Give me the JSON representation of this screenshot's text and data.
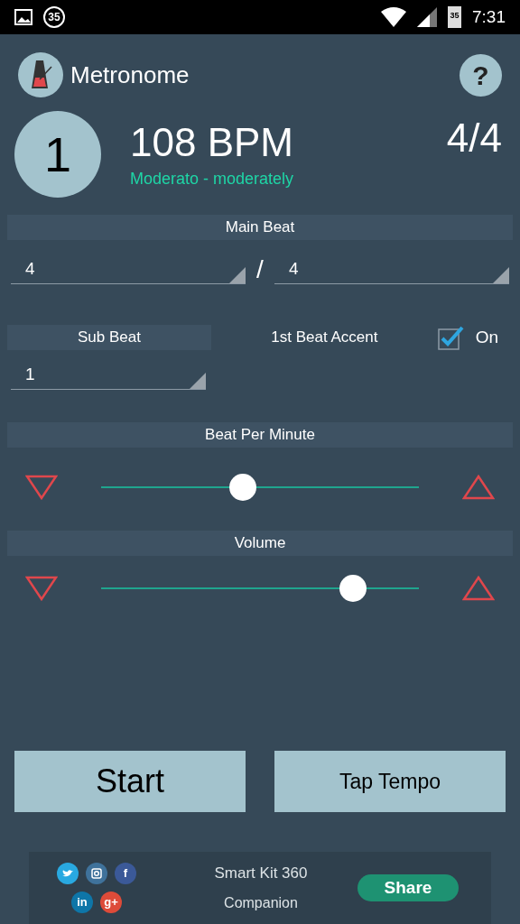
{
  "status_bar": {
    "badge": "35",
    "battery": "35",
    "time": "7:31"
  },
  "header": {
    "title": "Metronome",
    "help": "?"
  },
  "display": {
    "beat": "1",
    "tempo": "108 BPM",
    "tempo_name": "Moderato - moderately",
    "signature": "4/4"
  },
  "main_beat": {
    "title": "Main Beat",
    "numerator": "4",
    "separator": "/",
    "denominator": "4"
  },
  "sub_beat": {
    "title": "Sub Beat",
    "value": "1"
  },
  "accent": {
    "label": "1st Beat Accent",
    "checked": true,
    "state": "On"
  },
  "sliders": [
    {
      "title": "Beat Per Minute",
      "level": 0.44
    },
    {
      "title": "Volume",
      "level": 0.82
    }
  ],
  "buttons": [
    {
      "label": "Start",
      "kind": "primary"
    },
    {
      "label": "Tap Tempo",
      "kind": "secondary"
    }
  ],
  "ad": {
    "social": [
      {
        "kind": "bird",
        "color": "#29a9e1"
      },
      {
        "kind": "camera",
        "color": "#3f729b"
      },
      {
        "kind": "text",
        "label": "f",
        "color": "#3b5998"
      },
      {
        "kind": "text",
        "label": "in",
        "color": "#0e76a8"
      },
      {
        "kind": "text",
        "label": "g+",
        "color": "#dd4b39"
      }
    ],
    "line1": "Smart Kit 360",
    "line2": "Companion",
    "share": "Share"
  }
}
